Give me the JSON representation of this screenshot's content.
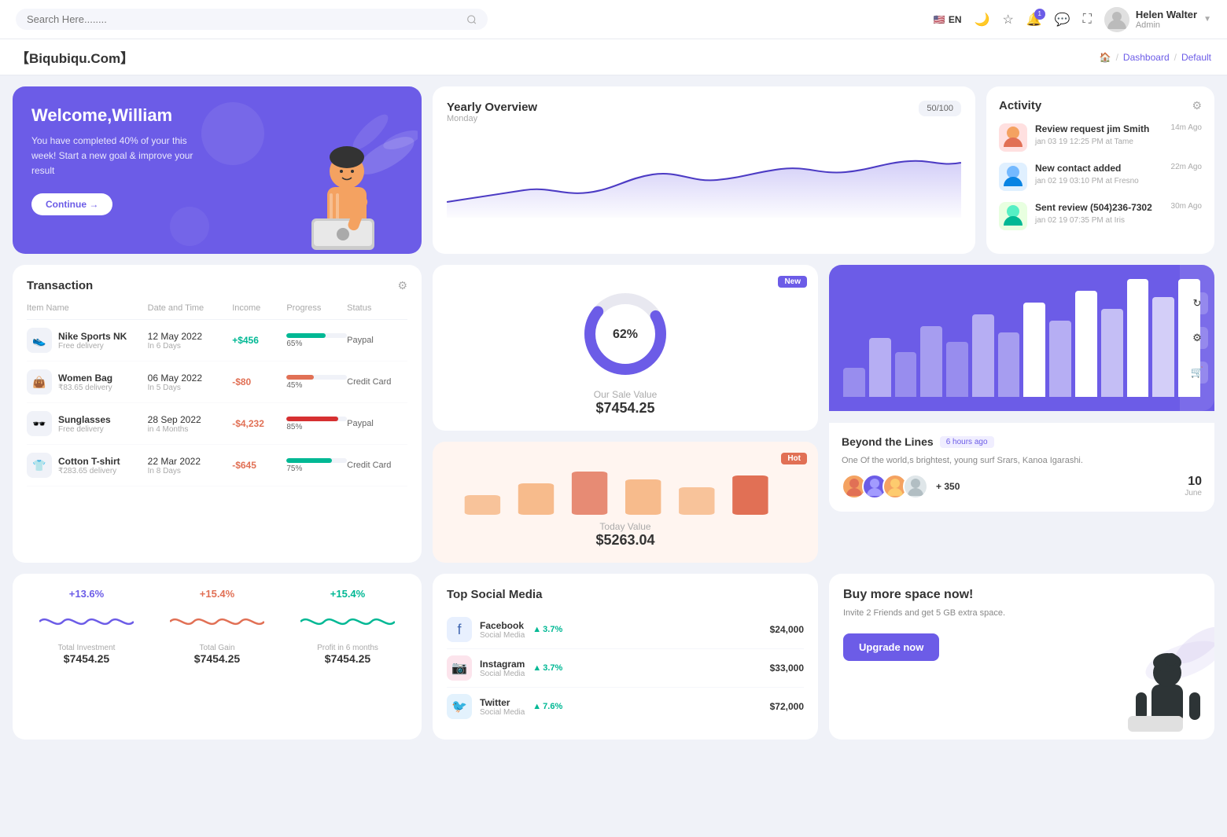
{
  "topnav": {
    "search_placeholder": "Search Here........",
    "lang": "EN",
    "bell_badge": "1",
    "username": "Helen Walter",
    "role": "Admin"
  },
  "brand": {
    "name": "【Biqubiqu.Com】",
    "breadcrumb": [
      "Home",
      "Dashboard",
      "Default"
    ]
  },
  "welcome": {
    "title": "Welcome,William",
    "description": "You have completed 40% of your this week! Start a new goal & improve your result",
    "button": "Continue →"
  },
  "yearly": {
    "title": "Yearly Overview",
    "subtitle": "Monday",
    "badge": "50/100"
  },
  "activity": {
    "title": "Activity",
    "items": [
      {
        "title": "Review request jim Smith",
        "detail": "jan 03 19 12:25 PM at Tame",
        "time": "14m Ago"
      },
      {
        "title": "New contact added",
        "detail": "jan 02 19 03:10 PM at Fresno",
        "time": "22m Ago"
      },
      {
        "title": "Sent review (504)236-7302",
        "detail": "jan 02 19 07:35 PM at Iris",
        "time": "30m Ago"
      }
    ]
  },
  "transaction": {
    "title": "Transaction",
    "columns": [
      "Item Name",
      "Date and Time",
      "Income",
      "Progress",
      "Status"
    ],
    "rows": [
      {
        "icon": "👟",
        "name": "Nike Sports NK",
        "sub": "Free delivery",
        "date": "12 May 2022",
        "date_sub": "In 6 Days",
        "income": "+$456",
        "income_type": "pos",
        "progress": 65,
        "progress_color": "#00b894",
        "status": "Paypal"
      },
      {
        "icon": "👜",
        "name": "Women Bag",
        "sub": "₹83.65 delivery",
        "date": "06 May 2022",
        "date_sub": "In 5 Days",
        "income": "-$80",
        "income_type": "neg",
        "progress": 45,
        "progress_color": "#e17055",
        "status": "Credit Card"
      },
      {
        "icon": "🕶️",
        "name": "Sunglasses",
        "sub": "Free delivery",
        "date": "28 Sep 2022",
        "date_sub": "in 4 Months",
        "income": "-$4,232",
        "income_type": "neg",
        "progress": 85,
        "progress_color": "#d63031",
        "status": "Paypal"
      },
      {
        "icon": "👕",
        "name": "Cotton T-shirt",
        "sub": "₹283.65 delivery",
        "date": "22 Mar 2022",
        "date_sub": "In 8 Days",
        "income": "-$645",
        "income_type": "neg",
        "progress": 75,
        "progress_color": "#00b894",
        "status": "Credit Card"
      }
    ]
  },
  "sale_new": {
    "badge": "New",
    "donut_percent": 62,
    "label": "Our Sale Value",
    "value": "$7454.25"
  },
  "sale_hot": {
    "badge": "Hot",
    "label": "Today Value",
    "value": "$5263.04"
  },
  "bar_chart": {
    "title": "Beyond the Lines",
    "time": "6 hours ago",
    "description": "One Of the world,s brightest, young surf Srars, Kanoa Igarashi.",
    "more_count": "+ 350",
    "event_date": "10",
    "event_month": "June",
    "bars": [
      30,
      60,
      45,
      70,
      55,
      80,
      65,
      90,
      75,
      100,
      85,
      110,
      95,
      120
    ]
  },
  "stats": [
    {
      "pct": "+13.6%",
      "label": "Total Investment",
      "value": "$7454.25",
      "color": "#6c5ce7"
    },
    {
      "pct": "+15.4%",
      "label": "Total Gain",
      "value": "$7454.25",
      "color": "#e17055"
    },
    {
      "pct": "+15.4%",
      "label": "Profit in 6 months",
      "value": "$7454.25",
      "color": "#00b894"
    }
  ],
  "social": {
    "title": "Top Social Media",
    "items": [
      {
        "icon": "📘",
        "name": "Facebook",
        "sub": "Social Media",
        "growth": "3.7%",
        "amount": "$24,000",
        "color": "#4267B2"
      },
      {
        "icon": "📸",
        "name": "Instagram",
        "sub": "Social Media",
        "growth": "3.7%",
        "amount": "$33,000",
        "color": "#E1306C"
      },
      {
        "icon": "🐦",
        "name": "Twitter",
        "sub": "Social Media",
        "growth": "7.6%",
        "amount": "$72,000",
        "color": "#1DA1F2"
      }
    ]
  },
  "upgrade": {
    "title": "Buy more space now!",
    "description": "Invite 2 Friends and get 5 GB extra space.",
    "button": "Upgrade now"
  }
}
